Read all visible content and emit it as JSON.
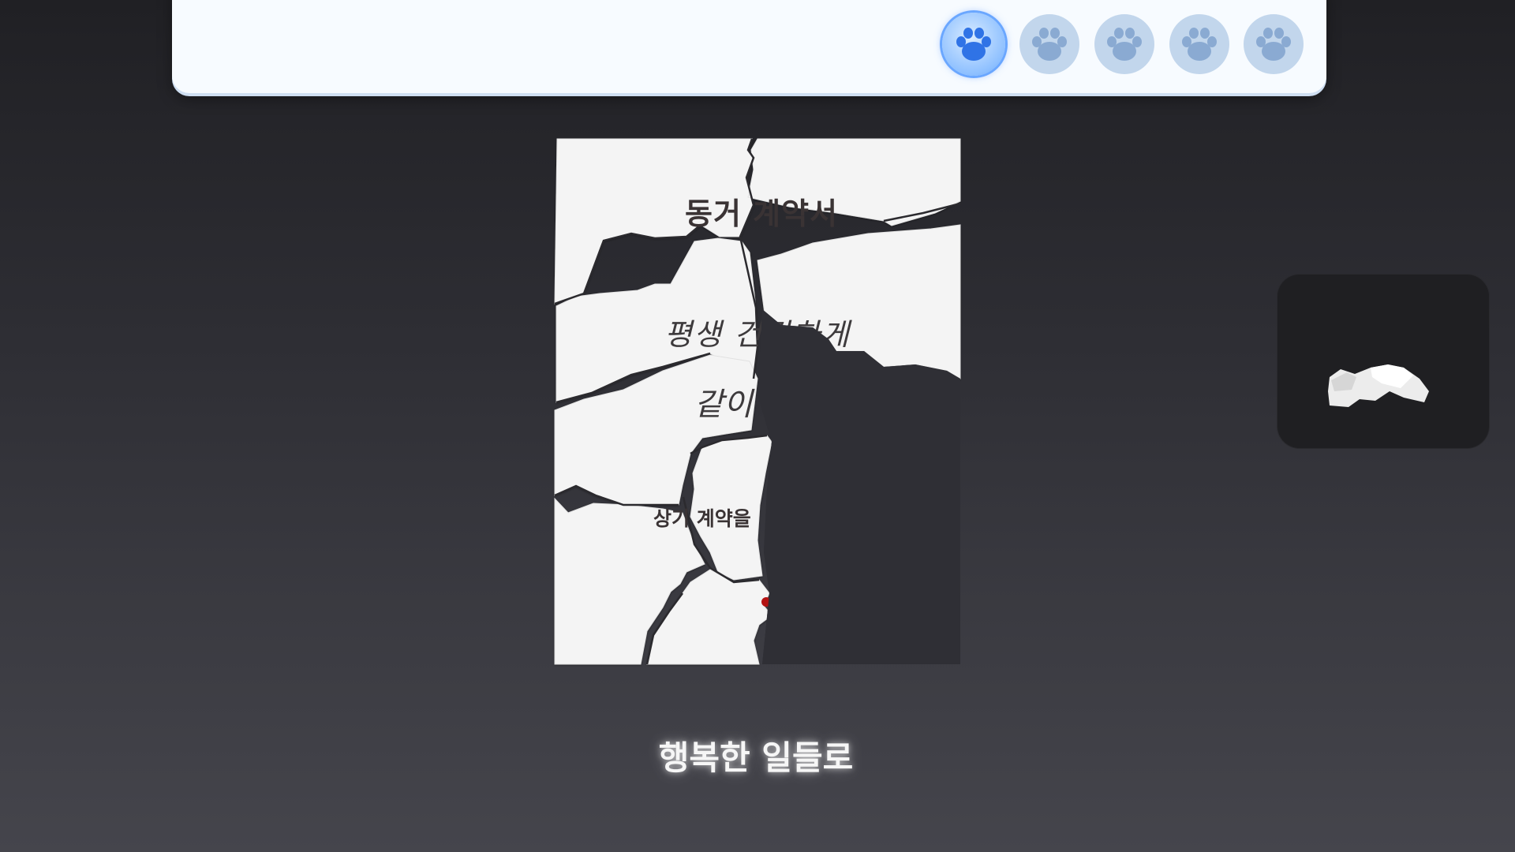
{
  "progress": {
    "current": 1,
    "total": 5,
    "slots": [
      {
        "icon": "paw-icon",
        "state": "active"
      },
      {
        "icon": "paw-icon",
        "state": "inactive"
      },
      {
        "icon": "paw-icon",
        "state": "inactive"
      },
      {
        "icon": "paw-icon",
        "state": "inactive"
      },
      {
        "icon": "paw-icon",
        "state": "inactive"
      }
    ]
  },
  "document": {
    "title": "동거 계약서",
    "line1": "평생 건강하게",
    "line2": "같이",
    "line3": "상기 계약을",
    "seal_color": "#b31212"
  },
  "piece_tray": {
    "icon": "paper-fragment-icon"
  },
  "subtitle": "행복한 일들로",
  "colors": {
    "paw_active": "#5f9ff2",
    "paw_inactive": "#c2d6ec",
    "paper": "#f4f4f4"
  }
}
